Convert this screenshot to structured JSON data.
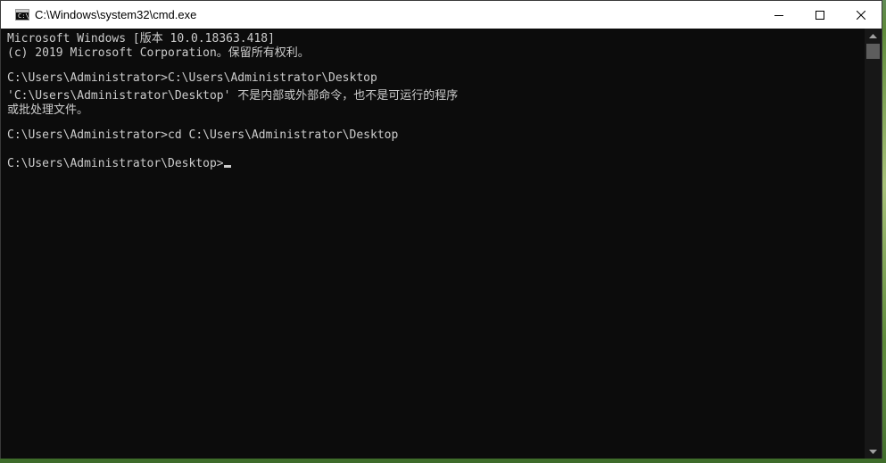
{
  "window": {
    "title": "C:\\Windows\\system32\\cmd.exe",
    "icon_label": "C:\\"
  },
  "controls": {
    "minimize": "minimize-icon",
    "maximize": "maximize-icon",
    "close": "close-icon"
  },
  "console": {
    "lines": [
      "Microsoft Windows [版本 10.0.18363.418]",
      "(c) 2019 Microsoft Corporation。保留所有权利。",
      "",
      "C:\\Users\\Administrator>C:\\Users\\Administrator\\Desktop",
      "'C:\\Users\\Administrator\\Desktop' 不是内部或外部命令，也不是可运行的程序",
      "或批处理文件。",
      "",
      "C:\\Users\\Administrator>cd C:\\Users\\Administrator\\Desktop",
      "",
      "C:\\Users\\Administrator\\Desktop>"
    ]
  },
  "colors": {
    "console_bg": "#0c0c0c",
    "console_fg": "#cccccc",
    "titlebar_bg": "#ffffff"
  }
}
